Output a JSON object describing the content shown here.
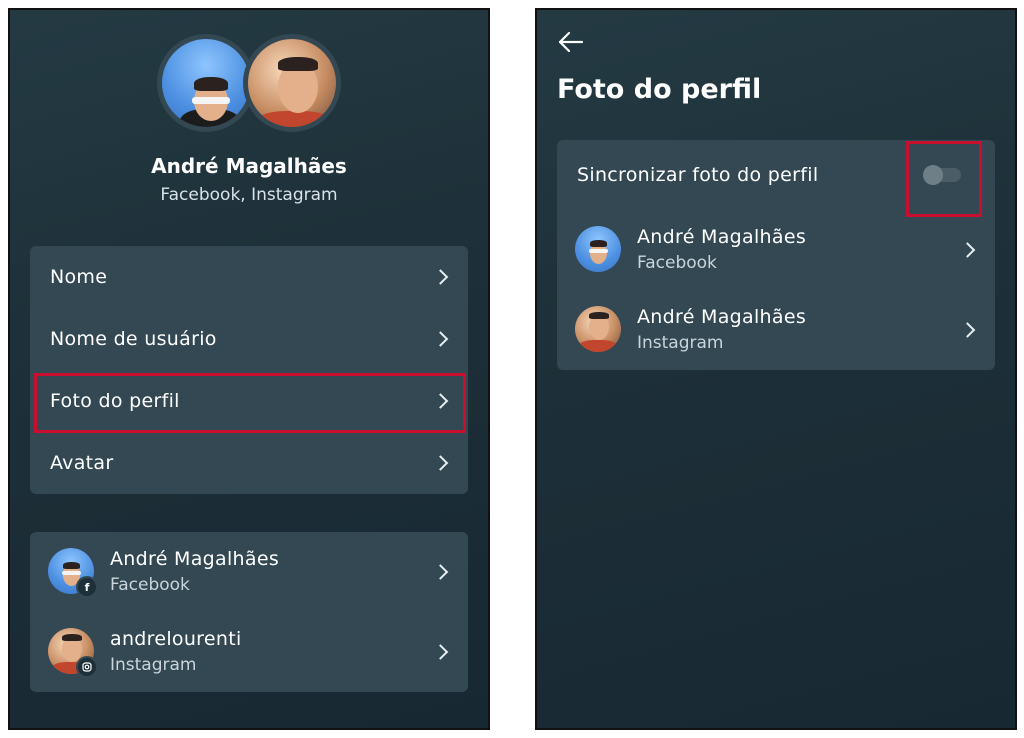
{
  "profile": {
    "name": "André Magalhães",
    "accounts_summary": "Facebook, Instagram"
  },
  "menu": {
    "items": [
      {
        "label": "Nome"
      },
      {
        "label": "Nome de usuário"
      },
      {
        "label": "Foto do perfil"
      },
      {
        "label": "Avatar"
      }
    ]
  },
  "accounts": [
    {
      "name": "André Magalhães",
      "platform": "Facebook",
      "badge_icon": "facebook-icon"
    },
    {
      "name": "andrelourenti",
      "platform": "Instagram",
      "badge_icon": "instagram-icon"
    }
  ],
  "photo_page": {
    "title": "Foto do perfil",
    "sync_label": "Sincronizar foto do perfil",
    "sync_enabled": false,
    "accounts": [
      {
        "name": "André Magalhães",
        "platform": "Facebook"
      },
      {
        "name": "André Magalhães",
        "platform": "Instagram"
      }
    ]
  },
  "colors": {
    "highlight": "#c8102e",
    "card": "#334852",
    "background": "#1d2f38"
  }
}
